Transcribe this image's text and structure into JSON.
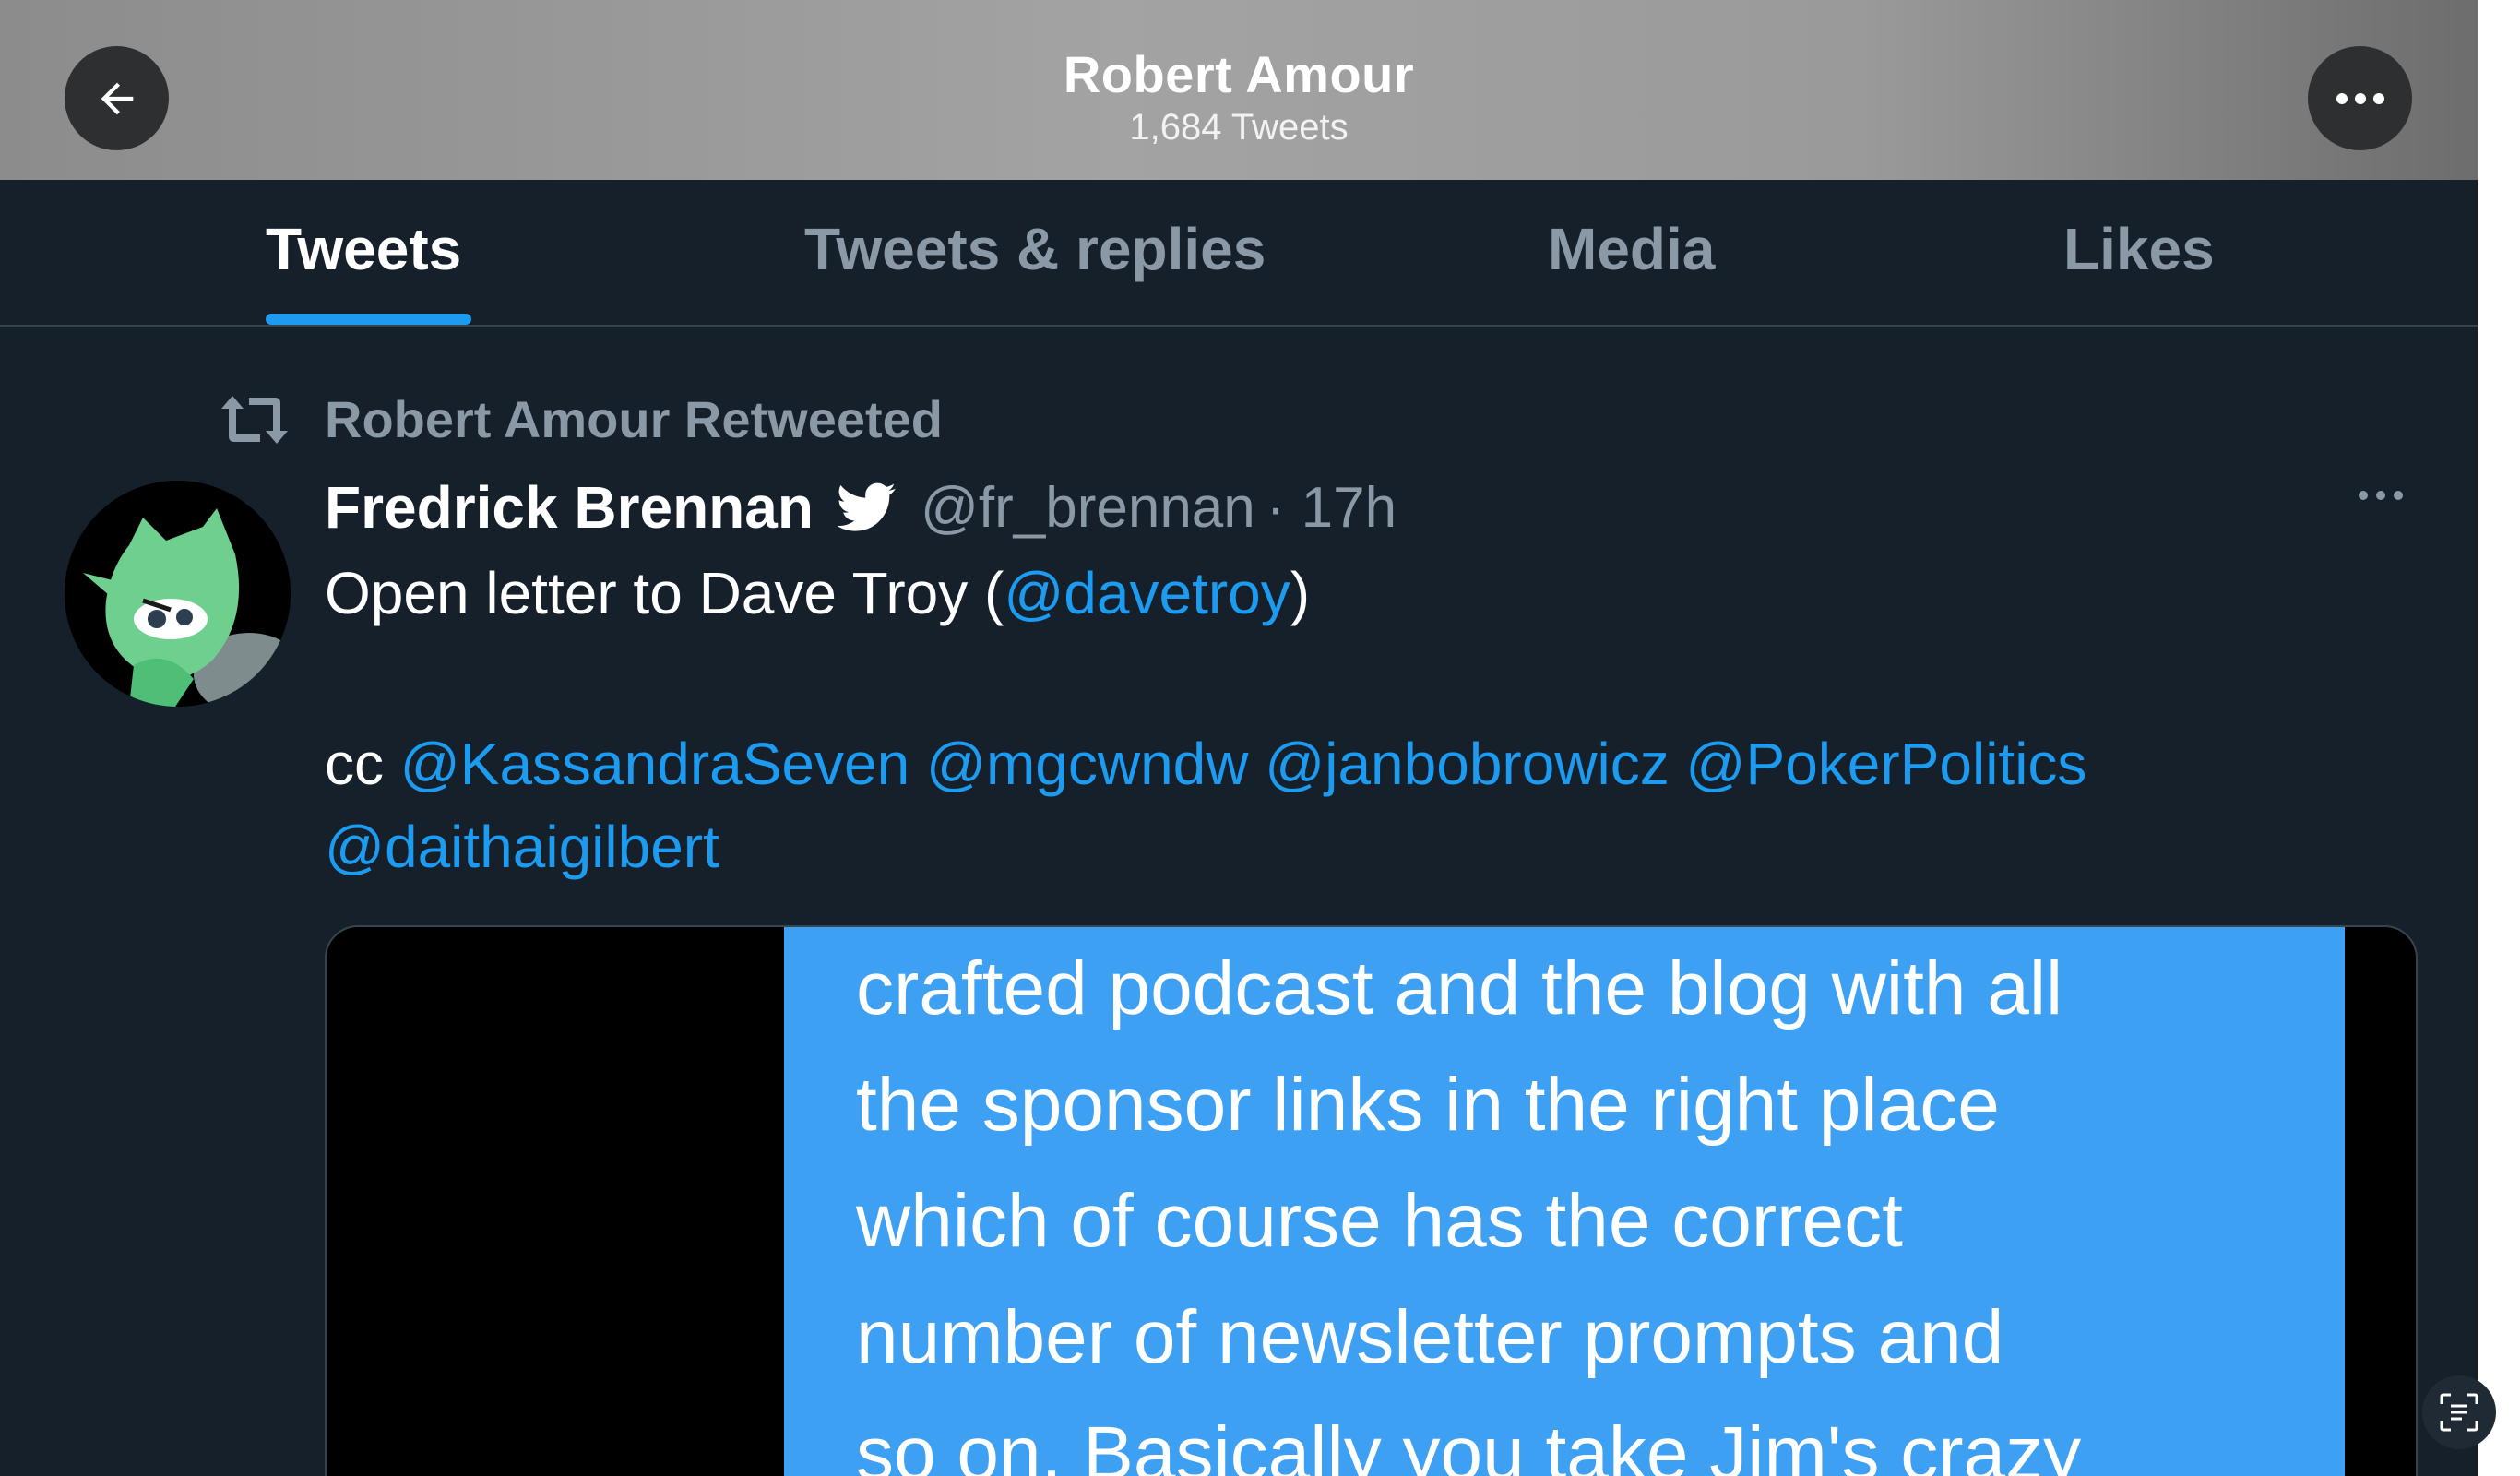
{
  "header": {
    "title": "Robert Amour",
    "subtitle": "1,684 Tweets",
    "back_icon": "arrow-left-icon",
    "more_icon": "ellipsis-icon"
  },
  "tabs": [
    {
      "label": "Tweets",
      "active": true
    },
    {
      "label": "Tweets & replies",
      "active": false
    },
    {
      "label": "Media",
      "active": false
    },
    {
      "label": "Likes",
      "active": false
    }
  ],
  "tweet": {
    "retweet_label": "Robert Amour Retweeted",
    "author_name": "Fredrick Brennan",
    "author_handle": "@fr_brennan",
    "time": "· 17h",
    "text_line1_prefix": "Open letter to Dave Troy (",
    "text_line1_mention": "@davetroy",
    "text_line1_suffix": ")",
    "cc_prefix": "cc ",
    "mentions": [
      "@KassandraSeven",
      "@mgcwndw",
      "@janbobrowicz",
      "@PokerPolitics",
      "@daithaigilbert"
    ],
    "media_lines": [
      "crafted podcast and the blog with all",
      "the sponsor links in the right place",
      "which of course has the correct",
      "number of newsletter prompts and",
      "so on. Basically you take Jim's crazy"
    ]
  },
  "colors": {
    "background": "#15202b",
    "accent": "#1d9bf0",
    "muted": "#8b98a5",
    "media_blue": "#3ea0f3"
  }
}
